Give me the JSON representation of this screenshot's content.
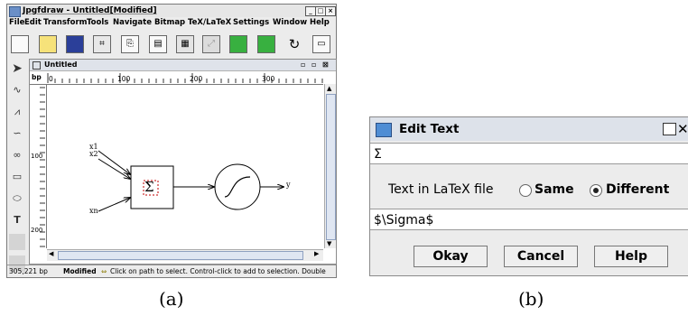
{
  "main_window": {
    "title": "Jpgfdraw - Untitled[Modified]",
    "menus": [
      "File",
      "Edit",
      "Transform",
      "Tools",
      "Navigate",
      "Bitmap",
      "TeX/LaTeX",
      "Settings",
      "Window",
      "Help"
    ],
    "toolbar_icons": [
      "new-file-icon",
      "open-folder-icon",
      "save-icon",
      "image-icon",
      "export-icon",
      "print-icon",
      "settings-icon",
      "grid-icon",
      "forward-icon",
      "back-icon",
      "undo-icon",
      "window-icon"
    ],
    "left_tools": [
      "select-tool-icon",
      "line-tool-icon",
      "zigzag-tool-icon",
      "curve-tool-icon",
      "loop-tool-icon",
      "rectangle-tool-icon",
      "ellipse-tool-icon",
      "text-tool-icon",
      "disabled-tool-icon",
      "disabled-tool-icon"
    ],
    "canvas_window_title": "Untitled",
    "ruler": {
      "unit": "bp",
      "top_labels": [
        "0",
        "100",
        "200",
        "300"
      ],
      "left_labels": [
        "100",
        "200"
      ]
    },
    "diagram": {
      "inputs": [
        "x1",
        "x2",
        "xn"
      ],
      "sum_symbol": "Σ",
      "output": "y"
    },
    "status": {
      "coords": "305,221 bp",
      "state": "Modified",
      "message": "Click on path to select. Control-click to add to selection. Double"
    }
  },
  "dialog": {
    "title": "Edit Text",
    "text_value": "Σ",
    "latex_label": "Text in LaTeX file",
    "option_same": "Same",
    "option_different": "Different",
    "selected_option": "Different",
    "latex_value": "$\\Sigma$",
    "buttons": {
      "okay": "Okay",
      "cancel": "Cancel",
      "help": "Help"
    }
  },
  "captions": {
    "a": "(a)",
    "b": "(b)"
  }
}
